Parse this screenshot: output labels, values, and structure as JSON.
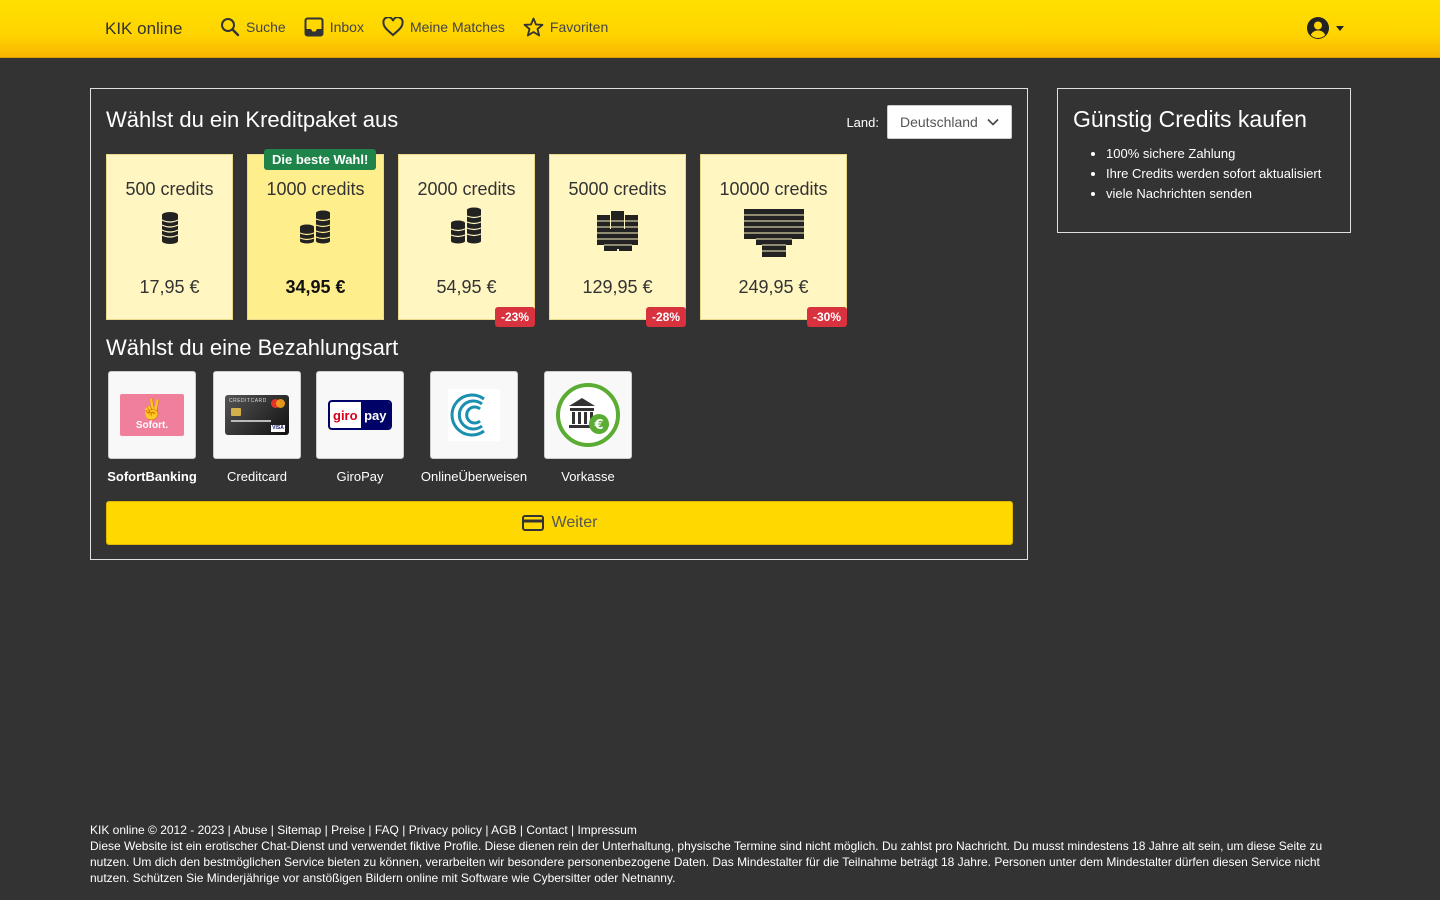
{
  "header": {
    "brand": "KIK online",
    "nav": [
      {
        "label": "Suche",
        "icon": "search-icon"
      },
      {
        "label": "Inbox",
        "icon": "inbox-icon"
      },
      {
        "label": "Meine Matches",
        "icon": "heart-icon"
      },
      {
        "label": "Favoriten",
        "icon": "star-icon"
      }
    ],
    "user_icon": "user-circle-icon"
  },
  "main": {
    "title": "Wählst du ein Kreditpaket aus",
    "country_label": "Land:",
    "country_value": "Deutschland",
    "best_badge": "Die beste Wahl!",
    "packages": [
      {
        "name": "500 credits",
        "price": "17,95 €",
        "discount": ""
      },
      {
        "name": "1000 credits",
        "price": "34,95 €",
        "discount": ""
      },
      {
        "name": "2000 credits",
        "price": "54,95 €",
        "discount": "-23%"
      },
      {
        "name": "5000 credits",
        "price": "129,95 €",
        "discount": "-28%"
      },
      {
        "name": "10000 credits",
        "price": "249,95 €",
        "discount": "-30%"
      }
    ],
    "payment_title": "Wählst du eine Bezahlungsart",
    "payments": [
      {
        "label": "SofortBanking",
        "logo_text": "Sofort."
      },
      {
        "label": "Creditcard",
        "logo_text": "CREDITCARD"
      },
      {
        "label": "GiroPay",
        "logo_text_1": "giro",
        "logo_text_2": "pay"
      },
      {
        "label": "OnlineÜberweisen",
        "logo_text": ""
      },
      {
        "label": "Vorkasse",
        "logo_text": "€"
      }
    ],
    "continue_label": "Weiter"
  },
  "sidebar": {
    "title": "Günstig Credits kaufen",
    "items": [
      "100% sichere Zahlung",
      "Ihre Credits werden sofort aktualisiert",
      "viele Nachrichten senden"
    ]
  },
  "footer": {
    "copyright": "KIK online © 2012 - 2023",
    "links": [
      "Abuse",
      "Sitemap",
      "Preise",
      "FAQ",
      "Privacy policy",
      "AGB",
      "Contact",
      "Impressum"
    ],
    "disclaimer": "Diese Website ist ein erotischer Chat-Dienst und verwendet fiktive Profile. Diese dienen rein der Unterhaltung, physische Termine sind nicht möglich. Du zahlst pro Nachricht. Du musst mindestens 18 Jahre alt sein, um diese Seite zu nutzen. Um dich den bestmöglichen Service bieten zu können, verarbeiten wir besondere personenbezogene Daten. Das Mindestalter für die Teilnahme beträgt 18 Jahre. Personen unter dem Mindestalter dürfen diesen Service nicht nutzen. Schützen Sie Minderjährige vor anstößigen Bildern online mit Software wie Cybersitter oder Netnanny."
  },
  "colors": {
    "header_yellow": "#ffd400",
    "background": "#333333",
    "package_bg": "#fff6c2",
    "best_badge": "#1e8449",
    "discount_badge": "#d9323f",
    "button_yellow": "#ffd800"
  }
}
